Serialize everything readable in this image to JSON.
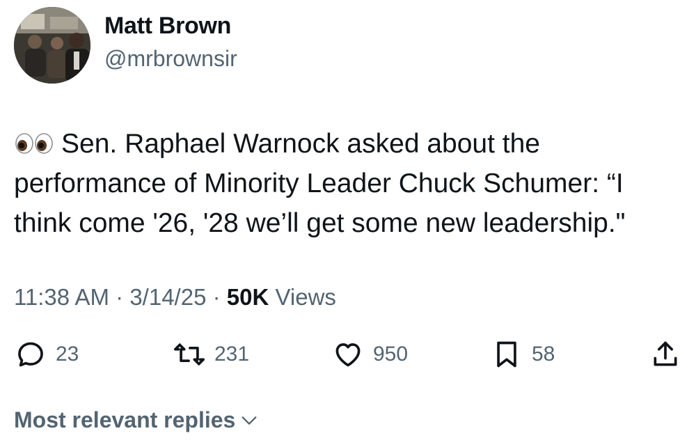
{
  "author": {
    "display_name": "Matt Brown",
    "handle": "@mrbrownsir"
  },
  "tweet": {
    "emoji": "eyes-emoji",
    "lines": [
      "Sen. Raphael Warnock asked about the",
      "performance of Minority Leader Chuck Schumer: “I",
      "think come '26, '28 we’ll get some new leadership.\""
    ]
  },
  "meta": {
    "time": "11:38 AM",
    "separator": "·",
    "date": "3/14/25",
    "views_count": "50K",
    "views_label": "Views"
  },
  "actions": {
    "replies": "23",
    "reposts": "231",
    "likes": "950",
    "bookmarks": "58"
  },
  "replies_sort": {
    "label": "Most relevant replies"
  },
  "colors": {
    "text": "#0f1419",
    "secondary": "#536471",
    "background": "#ffffff"
  }
}
